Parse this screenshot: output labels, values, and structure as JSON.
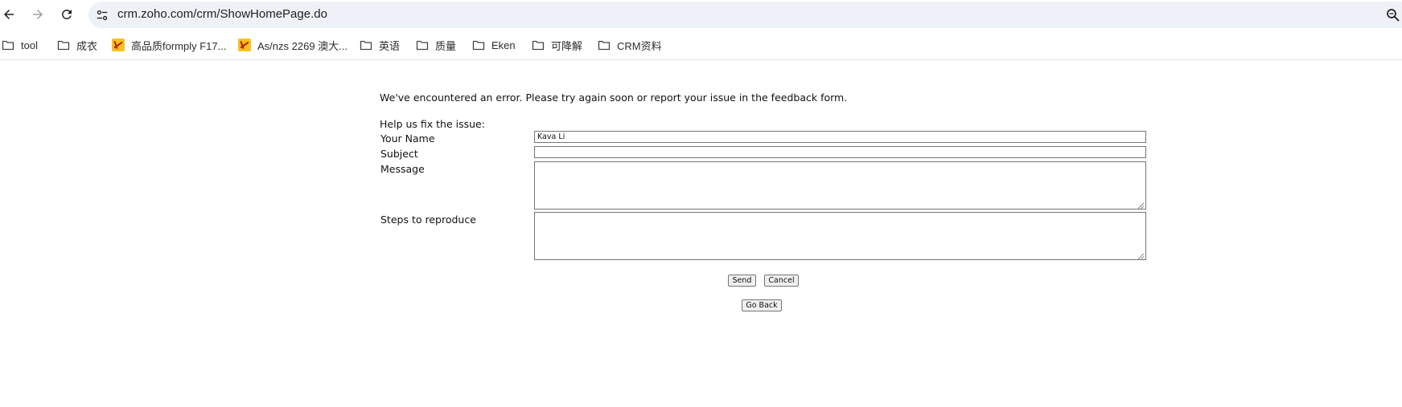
{
  "browser": {
    "url": "crm.zoho.com/crm/ShowHomePage.do",
    "back_icon": "arrow-left-icon",
    "forward_icon": "arrow-right-icon",
    "reload_icon": "reload-icon",
    "site_info_icon": "tune-icon",
    "zoom_icon": "magnifier-icon"
  },
  "bookmarks": [
    {
      "label": "tool",
      "icon": "folder-icon"
    },
    {
      "label": "成衣",
      "icon": "folder-icon"
    },
    {
      "label": "高品质formply F17...",
      "icon": "favicon"
    },
    {
      "label": "As/nzs 2269 澳大...",
      "icon": "favicon"
    },
    {
      "label": "英语",
      "icon": "folder-icon"
    },
    {
      "label": "质量",
      "icon": "folder-icon"
    },
    {
      "label": "Eken",
      "icon": "folder-icon"
    },
    {
      "label": "可降解",
      "icon": "folder-icon"
    },
    {
      "label": "CRM资料",
      "icon": "folder-icon"
    }
  ],
  "error_page": {
    "message": "We've encountered an error. Please try again soon or report your issue in the feedback form.",
    "help_heading": "Help us fix the issue:",
    "labels": {
      "name": "Your Name",
      "subject": "Subject",
      "message": "Message",
      "steps": "Steps to reproduce"
    },
    "values": {
      "name": "Kava Li",
      "subject": "",
      "message": "",
      "steps": ""
    },
    "buttons": {
      "send": "Send",
      "cancel": "Cancel",
      "go_back": "Go Back"
    }
  }
}
